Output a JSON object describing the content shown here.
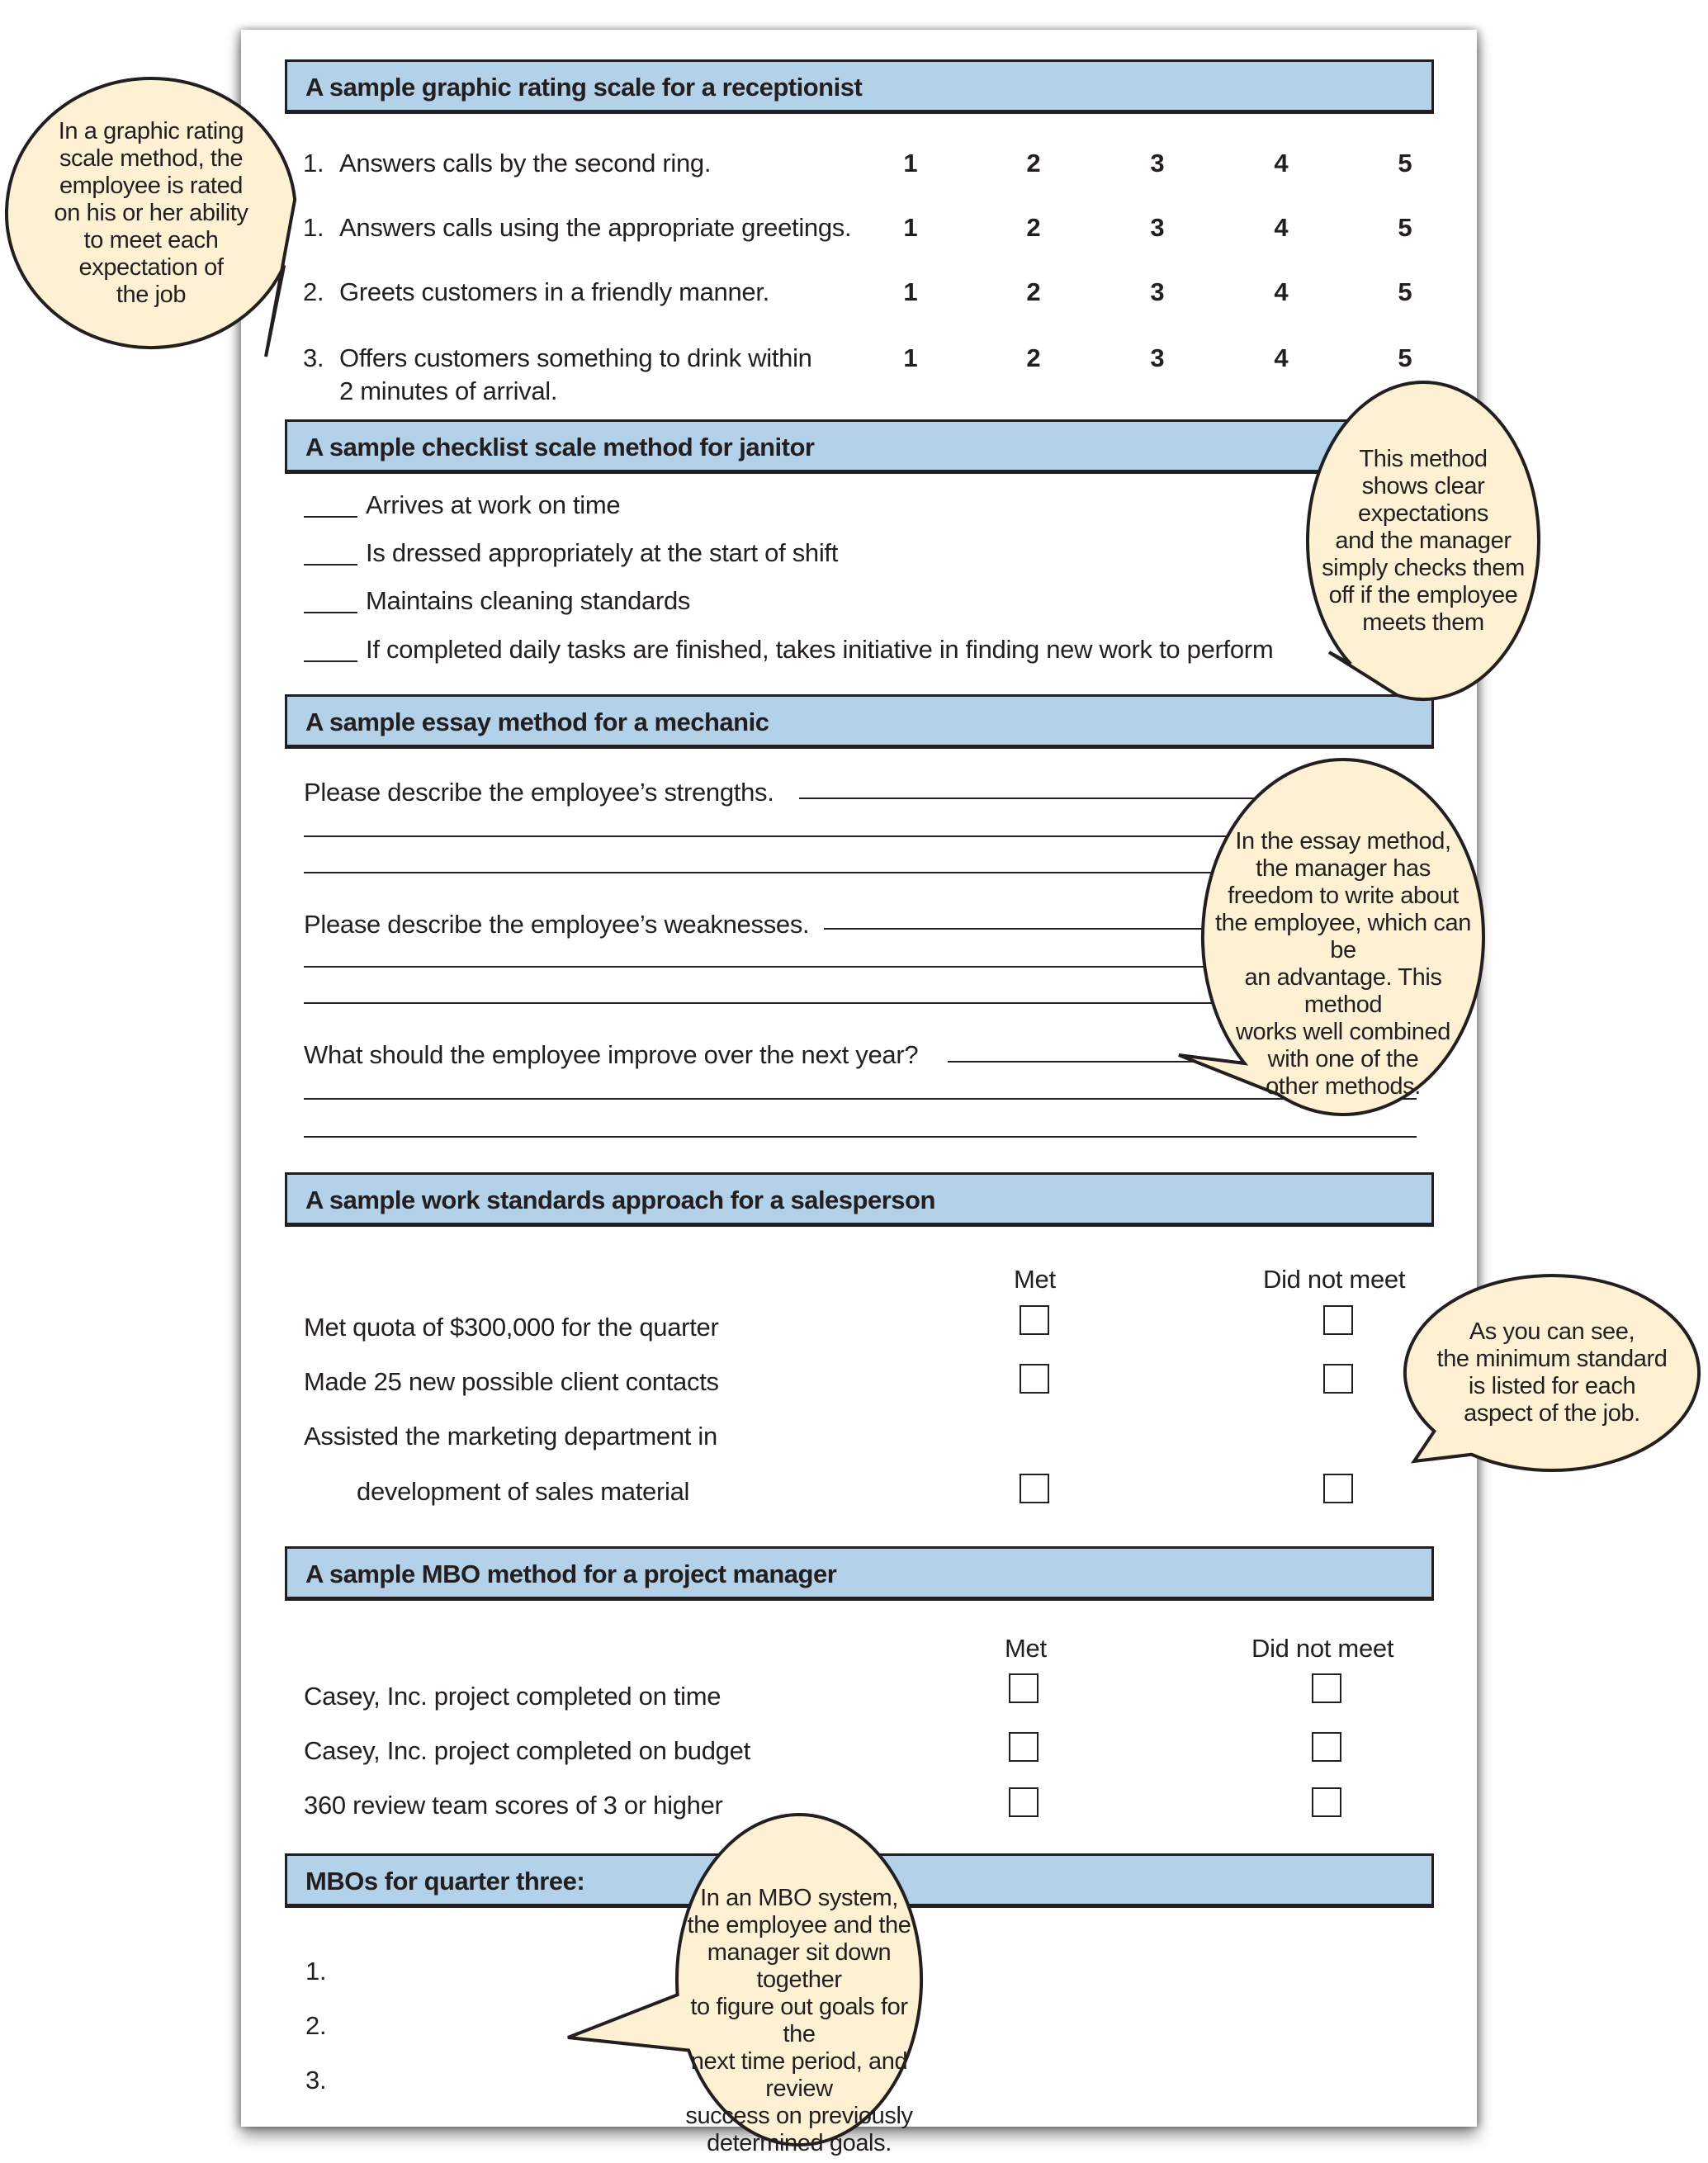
{
  "colors": {
    "header_fill": "#b3d1e8",
    "bubble_fill": "#fdf0d3",
    "ink": "#231f20"
  },
  "sections": {
    "graphic": {
      "title": "A sample graphic rating scale for a receptionist",
      "scale": [
        "1",
        "2",
        "3",
        "4",
        "5"
      ],
      "items": [
        {
          "num": "1.",
          "text": "Answers calls by the second ring."
        },
        {
          "num": "1.",
          "text": "Answers calls using the appropriate greetings."
        },
        {
          "num": "2.",
          "text": "Greets customers in a friendly manner."
        },
        {
          "num": "3.",
          "text": "Offers customers something to drink within",
          "text2": "2 minutes of arrival."
        }
      ]
    },
    "checklist": {
      "title": "A sample checklist scale method for janitor",
      "items": [
        "Arrives at work on time",
        "Is dressed appropriately at the start of shift",
        "Maintains cleaning standards",
        "If completed daily tasks are finished, takes initiative in finding new work to perform"
      ]
    },
    "essay": {
      "title": "A sample essay method for a mechanic",
      "questions": [
        "Please describe the employee’s strengths.",
        "Please describe the employee’s weaknesses.",
        "What should the employee improve over the next year?"
      ]
    },
    "standards": {
      "title": "A sample work standards approach for a salesperson",
      "col_met": "Met",
      "col_not_met": "Did not meet",
      "items": [
        "Met quota of $300,000 for the quarter",
        "Made 25 new possible client contacts",
        "Assisted the marketing department in",
        "development of sales material"
      ]
    },
    "mbo": {
      "title": "A sample MBO method for a project manager",
      "col_met": "Met",
      "col_not_met": "Did not meet",
      "items": [
        "Casey, Inc. project completed on time",
        "Casey, Inc. project completed on budget",
        "360 review team scores of 3 or higher"
      ]
    },
    "quarter": {
      "title": "MBOs for quarter three:",
      "items": [
        "1.",
        "2.",
        "3."
      ]
    }
  },
  "callouts": {
    "graphic": [
      "In a graphic rating",
      "scale method, the",
      "employee is rated",
      "on his or her ability",
      "to meet each",
      "expectation of",
      "the job"
    ],
    "checklist": [
      "This method",
      "shows clear",
      "expectations",
      "and the manager",
      "simply checks them",
      "off if the employee",
      "meets them"
    ],
    "essay": [
      "In the essay method,",
      "the manager has",
      "freedom to write about",
      "the employee, which can be",
      "an advantage.  This method",
      "works well combined",
      "with one of the",
      "other methods."
    ],
    "standards": [
      "As you can see,",
      "the minimum standard",
      "is listed for each",
      "aspect of the job."
    ],
    "mbo": [
      "In an MBO system,",
      "the employee and the",
      "manager sit down together",
      "to figure out goals for the",
      "next time period, and review",
      "success on previously",
      "determined goals."
    ]
  }
}
